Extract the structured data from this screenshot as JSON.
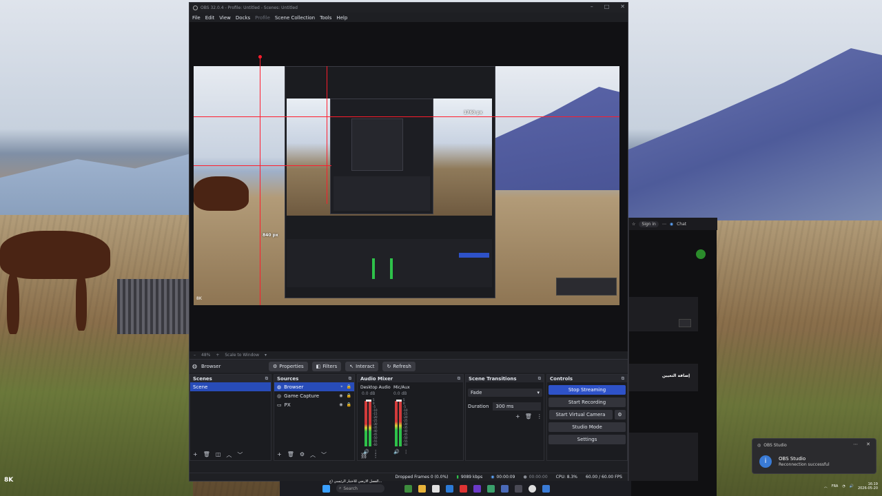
{
  "obs": {
    "title": "OBS 32.0.4 - Profile: Untitled - Scenes: Untitled",
    "menu": [
      "File",
      "Edit",
      "View",
      "Docks",
      "Profile",
      "Scene Collection",
      "Tools",
      "Help"
    ],
    "preview": {
      "px_width": "1760 px",
      "px_height": "840 px",
      "watermark": "8K"
    },
    "zoom": {
      "level": "48%",
      "mode": "Scale to Window"
    },
    "source_bar": {
      "selected": "Browser",
      "properties": "Properties",
      "filters": "Filters",
      "interact": "Interact",
      "refresh": "Refresh"
    },
    "scenes": {
      "title": "Scenes",
      "items": [
        "Scene"
      ]
    },
    "sources": {
      "title": "Sources",
      "items": [
        "Browser",
        "Game Capture",
        "PX"
      ]
    },
    "audio": {
      "title": "Audio Mixer",
      "channels": [
        {
          "name": "Desktop Audio",
          "db": "0.0 dB",
          "level": 0.55
        },
        {
          "name": "Mic/Aux",
          "db": "0.0 dB",
          "level": 0.6
        }
      ],
      "scale": [
        "5",
        "0",
        "-5",
        "-10",
        "-15",
        "-20",
        "-25",
        "-30",
        "-35",
        "-40",
        "-45",
        "-50",
        "-55",
        "-60"
      ]
    },
    "transitions": {
      "title": "Scene Transitions",
      "type": "Fade",
      "duration_label": "Duration",
      "duration": "300 ms"
    },
    "controls": {
      "title": "Controls",
      "stop_streaming": "Stop Streaming",
      "start_recording": "Start Recording",
      "start_virtual_camera": "Start Virtual Camera",
      "studio_mode": "Studio Mode",
      "settings": "Settings"
    },
    "status": {
      "dropped": "Dropped Frames 0 (0.0%)",
      "bitrate": "9089 kbps",
      "stream_time": "00:00:09",
      "rec_time": "00:00:00",
      "cpu": "CPU: 8.3%",
      "fps": "60.00 / 60.00 FPS"
    }
  },
  "desktop": {
    "watermark": "8K",
    "browser": {
      "sign_in": "Sign in",
      "chat": "Chat",
      "arabic_button": "إضافة التعيين"
    }
  },
  "taskbar": {
    "search": "Search",
    "news": "الفصل الارضي للاختبار الرئيسي (ع..."
  },
  "notification": {
    "app": "OBS Studio",
    "title": "OBS Studio",
    "message": "Reconnection successful"
  },
  "tray": {
    "lang": "FRA",
    "time": "16:19",
    "date": "2026-05-20"
  },
  "colors": {
    "accent": "#2e52c8",
    "guide": "#ff1c2c",
    "meter_green": "#2ec24a"
  }
}
